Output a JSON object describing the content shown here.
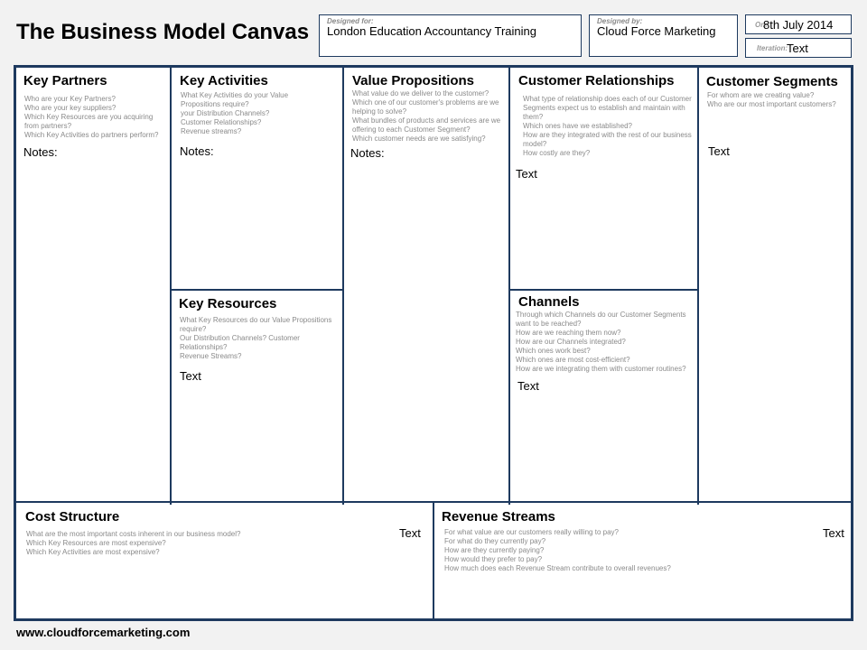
{
  "title": "The Business Model Canvas",
  "designed_for": {
    "label": "Designed for:",
    "value": "London Education Accountancy Training"
  },
  "designed_by": {
    "label": "Designed by:",
    "value": "Cloud Force Marketing"
  },
  "date": {
    "label": "On:",
    "value": "8th July 2014"
  },
  "iteration": {
    "label": "Iteration:",
    "value": "Text"
  },
  "key_partners": {
    "heading": "Key Partners",
    "questions": [
      "Who are your Key Partners?",
      "Who are your key suppliers?",
      "Which Key Resources are you acquiring from partners?",
      "Which Key Activities do partners perform?"
    ],
    "note": "Notes:"
  },
  "key_activities": {
    "heading": "Key Activities",
    "questions": [
      "What Key Activities do your Value Propositions require?",
      "your Distribution Channels?",
      "Customer Relationships?",
      "Revenue streams?"
    ],
    "note": "Notes:"
  },
  "key_resources": {
    "heading": "Key Resources",
    "questions": [
      "What Key Resources do our Value Propositions require?",
      "Our Distribution Channels? Customer Relationships?",
      "Revenue Streams?"
    ],
    "note": "Text"
  },
  "value_propositions": {
    "heading": "Value Propositions",
    "questions": [
      "What value do we deliver to the customer?",
      "Which one of our customer's problems are we helping to solve?",
      "What bundles of products and services are we offering to each Customer Segment?",
      "Which customer needs are we satisfying?"
    ],
    "note": "Notes:"
  },
  "customer_relationships": {
    "heading": "Customer Relationships",
    "questions": [
      "What type of relationship does each of our Customer Segments expect us to establish and maintain with them?",
      "Which ones have we established?",
      "How are they integrated with the rest of our business model?",
      "How costly are they?"
    ],
    "note": "Text"
  },
  "channels": {
    "heading": "Channels",
    "questions": [
      "Through which Channels do our Customer Segments want to be reached?",
      "How are we reaching them now?",
      "How are our Channels integrated?",
      "Which ones work best?",
      "Which ones are most cost-efficient?",
      "How are we integrating them with customer routines?"
    ],
    "note": "Text"
  },
  "customer_segments": {
    "heading": "Customer Segments",
    "questions": [
      "For whom are we creating value?",
      "Who are our most important customers?"
    ],
    "note": "Text"
  },
  "cost_structure": {
    "heading": "Cost Structure",
    "questions": [
      "What are the most important costs inherent in our business model?",
      "Which Key Resources are most expensive?",
      "Which Key Activities are most expensive?"
    ],
    "note": "Text"
  },
  "revenue_streams": {
    "heading": "Revenue Streams",
    "questions": [
      "For what value are our customers really willing to pay?",
      "For what do they currently pay?",
      "How are they currently paying?",
      "How would they prefer to pay?",
      "How much does each Revenue Stream contribute to overall revenues?"
    ],
    "note": "Text"
  },
  "footer": "www.cloudforcemarketing.com",
  "colors": {
    "border": "#1e3a5f",
    "question_text": "#8a8a8a"
  }
}
